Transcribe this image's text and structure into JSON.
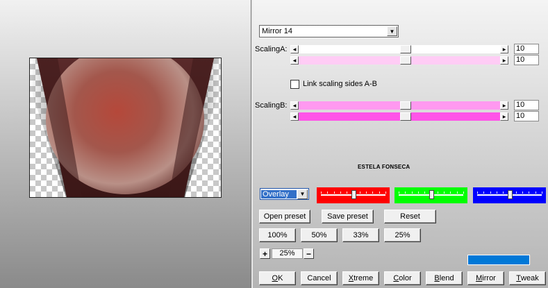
{
  "preset_combo": {
    "value": "Mirror 14"
  },
  "scaling_a": {
    "label": "ScalingA:",
    "value1": "10",
    "value2": "10",
    "pos1": 0.53,
    "pos2": 0.53
  },
  "link_checkbox": {
    "label": "Link scaling sides A-B",
    "checked": false
  },
  "scaling_b": {
    "label": "ScalingB:",
    "value1": "10",
    "value2": "10",
    "pos1": 0.53,
    "pos2": 0.53
  },
  "credit": "ESTELA FONSECA",
  "blend_combo": {
    "value": "Overlay"
  },
  "color_sliders": [
    {
      "name": "red",
      "color": "#ff0000",
      "pos": 0.51
    },
    {
      "name": "green",
      "color": "#00ff00",
      "pos": 0.51
    },
    {
      "name": "blue",
      "color": "#0000ff",
      "pos": 0.51
    }
  ],
  "preset_buttons": {
    "open": "Open preset",
    "save": "Save preset",
    "reset": "Reset"
  },
  "zoom_buttons": [
    "100%",
    "50%",
    "33%",
    "25%"
  ],
  "zoom": {
    "plus": "+",
    "value": "25%",
    "minus": "−"
  },
  "progress_color": "#0078d7",
  "colors": {
    "slider_a_track": "#ffffff",
    "slider_a2_track": "#ffccf5",
    "slider_b_track": "#ff99f0",
    "slider_b2_track": "#ff55e8"
  },
  "bottom_buttons": {
    "ok": {
      "ak": "O",
      "rest": "K"
    },
    "cancel": {
      "ak": "",
      "rest": "Cancel"
    },
    "xtreme": {
      "ak": "X",
      "rest": "treme"
    },
    "color": {
      "ak": "C",
      "rest": "olor"
    },
    "blend": {
      "ak": "B",
      "rest": "lend"
    },
    "mirror": {
      "ak": "M",
      "rest": "irror"
    },
    "tweak": {
      "ak": "T",
      "rest": "weak"
    }
  }
}
